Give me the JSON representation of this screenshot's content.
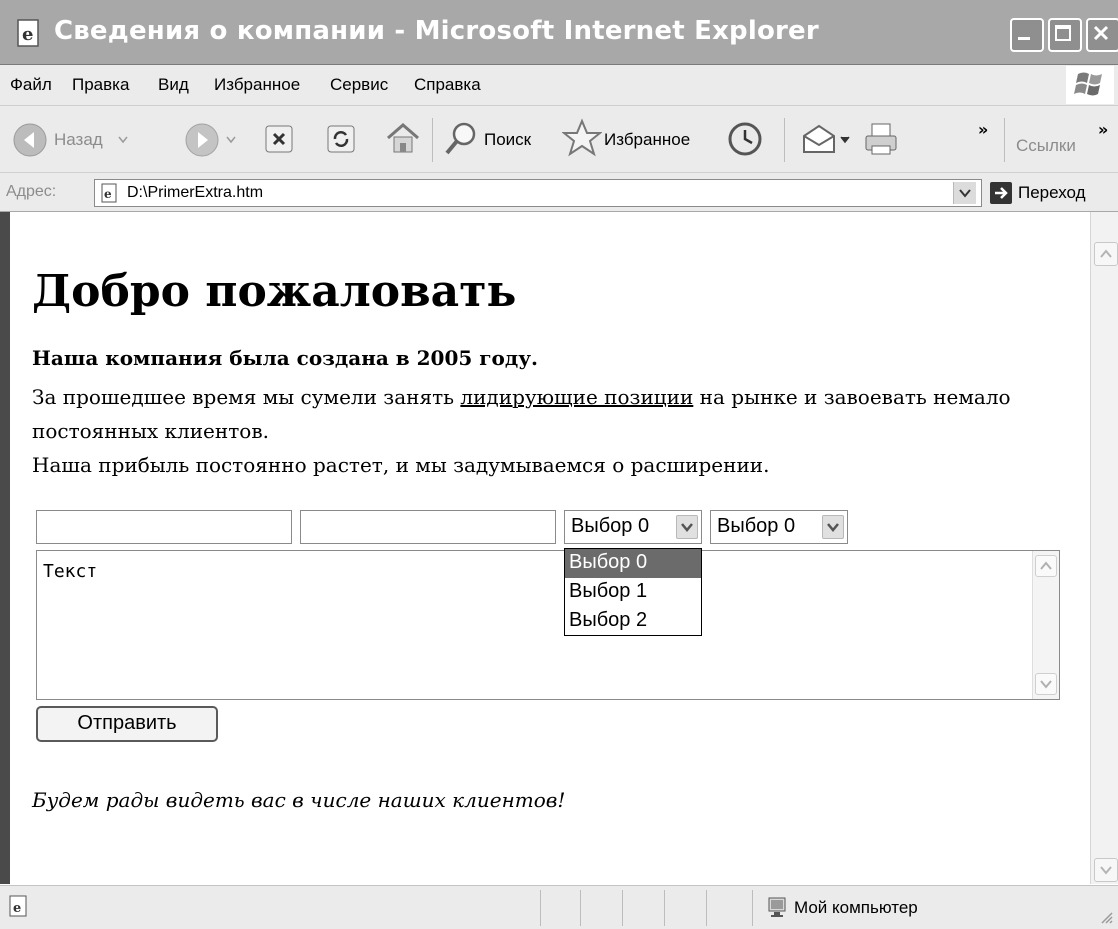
{
  "window": {
    "title": "Сведения о компании - Microsoft Internet Explorer"
  },
  "menu": {
    "items": [
      "Файл",
      "Правка",
      "Вид",
      "Избранное",
      "Сервис",
      "Справка"
    ]
  },
  "toolbar": {
    "back_label": "Назад",
    "search_label": "Поиск",
    "favorites_label": "Избранное",
    "more_symbol": "»",
    "links_label": "Ссылки"
  },
  "address": {
    "label": "Адрес:",
    "value": "D:\\PrimerExtra.htm",
    "go_label": "Переход"
  },
  "page": {
    "heading": "Добро пожаловать",
    "intro_bold": "Наша компания была создана в 2005 году.",
    "para1_before": "За прошедшее время мы сумели занять ",
    "para1_link": "лидирующие позиции",
    "para1_after": " на рынке и завоевать немало постоянных клиентов.",
    "para2": "Наша прибыль постоянно растет, и мы задумываемся о расширении.",
    "input1_value": "",
    "input2_value": "",
    "select1_value": "Выбор 0",
    "select2_value": "Выбор 0",
    "dropdown_options": [
      "Выбор 0",
      "Выбор 1",
      "Выбор 2"
    ],
    "dropdown_selected_index": 0,
    "textarea_value": "Текст",
    "submit_label": "Отправить",
    "outro": "Будем рады видеть вас в числе наших клиентов!"
  },
  "status": {
    "zone_label": "Мой компьютер"
  }
}
